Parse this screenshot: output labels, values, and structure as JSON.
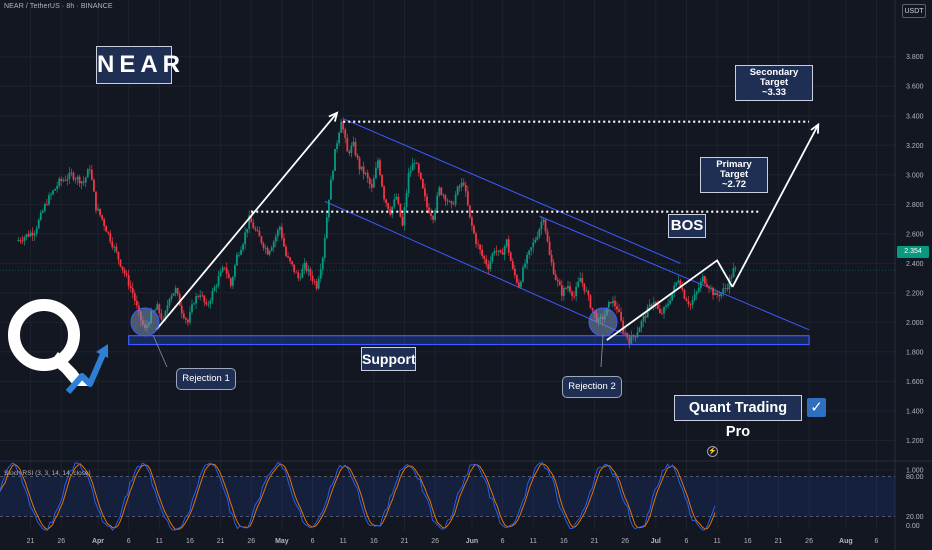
{
  "header": {
    "symbol_line": "NEAR / TetherUS · 8h · BINANCE",
    "currency": "USDT"
  },
  "logo_text": "NEAR",
  "annotations": {
    "secondary_target": {
      "line1": "Secondary Target",
      "line2": "~3.33"
    },
    "primary_target": {
      "line1": "Primary Target",
      "line2": "~2.72"
    },
    "bos": "BOS",
    "support": "Support",
    "rejection_1": "Rejection 1",
    "rejection_2": "Rejection 2",
    "brand": "Quant Trading Pro",
    "check_glyph": "✓",
    "alert_glyph": "⚡"
  },
  "indicator": {
    "label": "Stoch RSI (3, 3, 14, 14, close)"
  },
  "colors": {
    "up": "#089981",
    "down": "#f23645",
    "channel": "#3d5afe",
    "k_line": "#2962ff",
    "d_line": "#f57c00",
    "background": "#131722",
    "label_bg": "#1f2f54"
  },
  "chart_data": [
    {
      "type": "candlestick",
      "title": "",
      "last_price": "2.354",
      "y_axis": {
        "range": [
          1.0,
          3.9
        ],
        "tick_labels": [
          "3.800",
          "3.600",
          "3.400",
          "3.200",
          "3.000",
          "2.800",
          "2.600",
          "2.400",
          "2.200",
          "2.000",
          "1.800",
          "1.600",
          "1.400",
          "1.200",
          "1.000"
        ]
      },
      "x_axis": {
        "range_days": [
          -11,
          158
        ],
        "ticks": [
          {
            "label": "21",
            "day": -11
          },
          {
            "label": "26",
            "day": -6
          },
          {
            "label": "Apr",
            "day": 0
          },
          {
            "label": "6",
            "day": 5
          },
          {
            "label": "11",
            "day": 10
          },
          {
            "label": "16",
            "day": 15
          },
          {
            "label": "21",
            "day": 20
          },
          {
            "label": "26",
            "day": 25
          },
          {
            "label": "May",
            "day": 30
          },
          {
            "label": "6",
            "day": 35
          },
          {
            "label": "11",
            "day": 40
          },
          {
            "label": "16",
            "day": 45
          },
          {
            "label": "21",
            "day": 50
          },
          {
            "label": "26",
            "day": 55
          },
          {
            "label": "Jun",
            "day": 61
          },
          {
            "label": "6",
            "day": 66
          },
          {
            "label": "11",
            "day": 71
          },
          {
            "label": "16",
            "day": 76
          },
          {
            "label": "21",
            "day": 81
          },
          {
            "label": "26",
            "day": 86
          },
          {
            "label": "Jul",
            "day": 91
          },
          {
            "label": "6",
            "day": 96
          },
          {
            "label": "11",
            "day": 101
          },
          {
            "label": "16",
            "day": 106
          },
          {
            "label": "21",
            "day": 111
          },
          {
            "label": "26",
            "day": 116
          },
          {
            "label": "Aug",
            "day": 122
          },
          {
            "label": "6",
            "day": 127
          }
        ]
      },
      "price_path": [
        [
          -13,
          2.55
        ],
        [
          -10,
          2.62
        ],
        [
          -8,
          2.82
        ],
        [
          -6,
          2.95
        ],
        [
          -4,
          3.0
        ],
        [
          -2,
          2.95
        ],
        [
          -1,
          3.05
        ],
        [
          0,
          2.78
        ],
        [
          1,
          2.7
        ],
        [
          2,
          2.6
        ],
        [
          4,
          2.4
        ],
        [
          6,
          2.2
        ],
        [
          7,
          2.05
        ],
        [
          8,
          1.95
        ],
        [
          9,
          2.05
        ],
        [
          10,
          2.1
        ],
        [
          11,
          2.0
        ],
        [
          12,
          2.18
        ],
        [
          13,
          2.22
        ],
        [
          14,
          2.08
        ],
        [
          15,
          2.0
        ],
        [
          16,
          2.15
        ],
        [
          17,
          2.2
        ],
        [
          18,
          2.1
        ],
        [
          20,
          2.3
        ],
        [
          21,
          2.38
        ],
        [
          22,
          2.25
        ],
        [
          23,
          2.45
        ],
        [
          24,
          2.55
        ],
        [
          25,
          2.7
        ],
        [
          26,
          2.62
        ],
        [
          27,
          2.55
        ],
        [
          28,
          2.48
        ],
        [
          29,
          2.55
        ],
        [
          30,
          2.65
        ],
        [
          31,
          2.45
        ],
        [
          32,
          2.38
        ],
        [
          33,
          2.3
        ],
        [
          34,
          2.38
        ],
        [
          35,
          2.32
        ],
        [
          36,
          2.25
        ],
        [
          37,
          2.45
        ],
        [
          38,
          2.85
        ],
        [
          39,
          3.15
        ],
        [
          40,
          3.38
        ],
        [
          41,
          3.15
        ],
        [
          42,
          3.2
        ],
        [
          43,
          3.05
        ],
        [
          44,
          3.0
        ],
        [
          45,
          2.9
        ],
        [
          46,
          3.1
        ],
        [
          47,
          2.85
        ],
        [
          48,
          2.75
        ],
        [
          49,
          2.85
        ],
        [
          50,
          2.65
        ],
        [
          51,
          3.0
        ],
        [
          52,
          3.1
        ],
        [
          53,
          2.95
        ],
        [
          54,
          2.78
        ],
        [
          55,
          2.72
        ],
        [
          56,
          2.9
        ],
        [
          57,
          2.85
        ],
        [
          58,
          2.78
        ],
        [
          59,
          2.9
        ],
        [
          60,
          2.95
        ],
        [
          61,
          2.7
        ],
        [
          62,
          2.55
        ],
        [
          63,
          2.45
        ],
        [
          64,
          2.38
        ],
        [
          65,
          2.5
        ],
        [
          66,
          2.45
        ],
        [
          67,
          2.55
        ],
        [
          68,
          2.35
        ],
        [
          69,
          2.25
        ],
        [
          70,
          2.4
        ],
        [
          71,
          2.5
        ],
        [
          72,
          2.6
        ],
        [
          73,
          2.72
        ],
        [
          74,
          2.45
        ],
        [
          75,
          2.3
        ],
        [
          76,
          2.2
        ],
        [
          77,
          2.25
        ],
        [
          78,
          2.18
        ],
        [
          79,
          2.3
        ],
        [
          80,
          2.2
        ],
        [
          81,
          2.08
        ],
        [
          82,
          2.0
        ],
        [
          83,
          2.05
        ],
        [
          84,
          2.15
        ],
        [
          85,
          2.1
        ],
        [
          86,
          1.95
        ],
        [
          87,
          1.88
        ],
        [
          88,
          1.92
        ],
        [
          89,
          2.0
        ],
        [
          90,
          2.08
        ],
        [
          91,
          2.15
        ],
        [
          92,
          2.05
        ],
        [
          93,
          2.1
        ],
        [
          94,
          2.2
        ],
        [
          95,
          2.3
        ],
        [
          96,
          2.18
        ],
        [
          97,
          2.12
        ],
        [
          98,
          2.2
        ],
        [
          99,
          2.3
        ],
        [
          100,
          2.25
        ],
        [
          101,
          2.18
        ],
        [
          102,
          2.2
        ],
        [
          103,
          2.25
        ],
        [
          104,
          2.354
        ]
      ],
      "stoch_rsi": {
        "range": [
          0,
          100
        ],
        "levels": [
          "80.00",
          "20.00"
        ],
        "level_values": [
          80,
          20
        ],
        "zero_label": "0.00"
      }
    }
  ]
}
